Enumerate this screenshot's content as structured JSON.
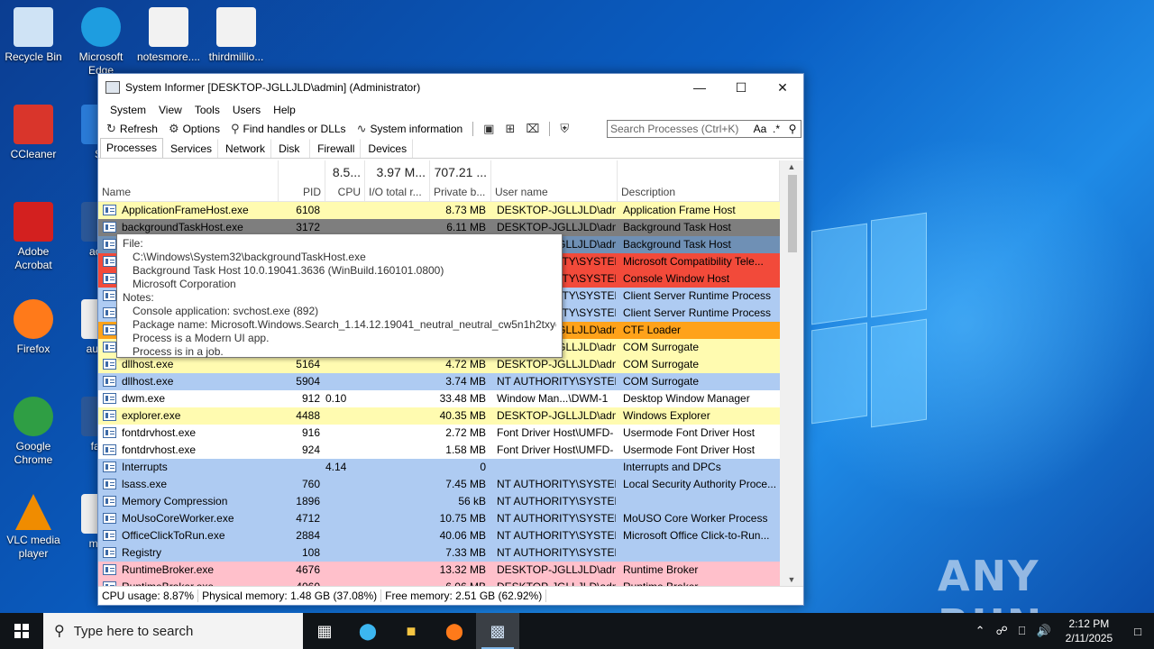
{
  "desktop": {
    "icons": [
      {
        "label": "Recycle Bin",
        "icon": "recycle-bin-icon",
        "color": "#cfe3f5"
      },
      {
        "label": "Microsoft Edge",
        "icon": "edge-icon",
        "color": "#1e9de0"
      },
      {
        "label": "notesmore....",
        "icon": "image-file-icon",
        "color": "#f2f2f2"
      },
      {
        "label": "thirdmillio...",
        "icon": "image-file-icon",
        "color": "#f2f2f2"
      },
      {
        "label": "CCleaner",
        "icon": "ccleaner-icon",
        "color": "#d9352b"
      },
      {
        "label": "Sk",
        "icon": "shortcut-icon",
        "color": "#2a7ad6"
      },
      {
        "label": "Adobe Acrobat",
        "icon": "acrobat-icon",
        "color": "#d3201f"
      },
      {
        "label": "acad",
        "icon": "word-icon",
        "color": "#2b5797"
      },
      {
        "label": "Firefox",
        "icon": "firefox-icon",
        "color": "#ff7a1a"
      },
      {
        "label": "augus",
        "icon": "file-icon",
        "color": "#eeeeee"
      },
      {
        "label": "Google Chrome",
        "icon": "chrome-icon",
        "color": "#2f9e44"
      },
      {
        "label": "fami",
        "icon": "word-icon",
        "color": "#2b5797"
      },
      {
        "label": "VLC media player",
        "icon": "vlc-icon",
        "color": "#f08c00"
      },
      {
        "label": "moth",
        "icon": "file-icon",
        "color": "#eeeeee"
      }
    ],
    "watermark": "ANY RUN"
  },
  "window": {
    "title": "System Informer [DESKTOP-JGLLJLD\\admin] (Administrator)",
    "menu": [
      "System",
      "View",
      "Tools",
      "Users",
      "Help"
    ],
    "toolbar": {
      "refresh": "Refresh",
      "options": "Options",
      "find": "Find handles or DLLs",
      "sysinfo": "System information"
    },
    "search_placeholder": "Search Processes (Ctrl+K)",
    "search_case": "Aa",
    "search_regex": ".*",
    "tabs": [
      "Processes",
      "Services",
      "Network",
      "Disk",
      "Firewall",
      "Devices"
    ],
    "columns": {
      "name": "Name",
      "pid": "PID",
      "cpu": "CPU",
      "cpu_total": "8.5...",
      "io": "I/O total r...",
      "io_total": "3.97 M...",
      "private": "Private b...",
      "private_total": "707.21 ...",
      "user": "User name",
      "desc": "Description"
    },
    "rows": [
      {
        "name": "ApplicationFrameHost.exe",
        "pid": "6108",
        "cpu": "",
        "priv": "8.73 MB",
        "user": "DESKTOP-JGLLJLD\\admi",
        "desc": "Application Frame Host",
        "bg": "#fffbb0"
      },
      {
        "name": "backgroundTaskHost.exe",
        "pid": "3172",
        "cpu": "",
        "priv": "6.11 MB",
        "user": "DESKTOP-JGLLJLD\\admi",
        "desc": "Background Task Host",
        "bg": "#7e7e7e"
      },
      {
        "name": "",
        "pid": "",
        "cpu": "",
        "priv": "",
        "user": "DESKTOP-JGLLJLD\\admi",
        "desc": "Background Task Host",
        "bg": "#6f90b5"
      },
      {
        "name": "",
        "pid": "",
        "cpu": "",
        "priv": "",
        "user": "NT AUTHORITY\\SYSTEM",
        "desc": "Microsoft Compatibility Tele...",
        "bg": "#f24a3a"
      },
      {
        "name": "",
        "pid": "",
        "cpu": "",
        "priv": "",
        "user": "NT AUTHORITY\\SYSTEM",
        "desc": "Console Window Host",
        "bg": "#f24a3a"
      },
      {
        "name": "",
        "pid": "",
        "cpu": "",
        "priv": "",
        "user": "NT AUTHORITY\\SYSTEM",
        "desc": "Client Server Runtime Process",
        "bg": "#aecbf2"
      },
      {
        "name": "",
        "pid": "",
        "cpu": "",
        "priv": "",
        "user": "NT AUTHORITY\\SYSTEM",
        "desc": "Client Server Runtime Process",
        "bg": "#aecbf2"
      },
      {
        "name": "",
        "pid": "",
        "cpu": "",
        "priv": "",
        "user": "DESKTOP-JGLLJLD\\admi",
        "desc": "CTF Loader",
        "bg": "#ffa21a"
      },
      {
        "name": "",
        "pid": "",
        "cpu": "",
        "priv": "",
        "user": "DESKTOP-JGLLJLD\\admi",
        "desc": "COM Surrogate",
        "bg": "#fffbb0"
      },
      {
        "name": "dllhost.exe",
        "pid": "5164",
        "cpu": "",
        "priv": "4.72 MB",
        "user": "DESKTOP-JGLLJLD\\admi",
        "desc": "COM Surrogate",
        "bg": "#fffbb0"
      },
      {
        "name": "dllhost.exe",
        "pid": "5904",
        "cpu": "",
        "priv": "3.74 MB",
        "user": "NT AUTHORITY\\SYSTEM",
        "desc": "COM Surrogate",
        "bg": "#aecbf2"
      },
      {
        "name": "dwm.exe",
        "pid": "912",
        "cpu": "0.10",
        "priv": "33.48 MB",
        "user": "Window Man...\\DWM-1",
        "desc": "Desktop Window Manager",
        "bg": "#ffffff"
      },
      {
        "name": "explorer.exe",
        "pid": "4488",
        "cpu": "",
        "priv": "40.35 MB",
        "user": "DESKTOP-JGLLJLD\\admi",
        "desc": "Windows Explorer",
        "bg": "#fffbb0"
      },
      {
        "name": "fontdrvhost.exe",
        "pid": "916",
        "cpu": "",
        "priv": "2.72 MB",
        "user": "Font Driver Host\\UMFD-",
        "desc": "Usermode Font Driver Host",
        "bg": "#ffffff"
      },
      {
        "name": "fontdrvhost.exe",
        "pid": "924",
        "cpu": "",
        "priv": "1.58 MB",
        "user": "Font Driver Host\\UMFD-",
        "desc": "Usermode Font Driver Host",
        "bg": "#ffffff"
      },
      {
        "name": "Interrupts",
        "pid": "",
        "cpu": "4.14",
        "priv": "0",
        "user": "",
        "desc": "Interrupts and DPCs",
        "bg": "#aecbf2"
      },
      {
        "name": "lsass.exe",
        "pid": "760",
        "cpu": "",
        "priv": "7.45 MB",
        "user": "NT AUTHORITY\\SYSTEM",
        "desc": "Local Security Authority Proce...",
        "bg": "#aecbf2"
      },
      {
        "name": "Memory Compression",
        "pid": "1896",
        "cpu": "",
        "priv": "56 kB",
        "user": "NT AUTHORITY\\SYSTEM",
        "desc": "",
        "bg": "#aecbf2"
      },
      {
        "name": "MoUsoCoreWorker.exe",
        "pid": "4712",
        "cpu": "",
        "priv": "10.75 MB",
        "user": "NT AUTHORITY\\SYSTEM",
        "desc": "MoUSO Core Worker Process",
        "bg": "#aecbf2"
      },
      {
        "name": "OfficeClickToRun.exe",
        "pid": "2884",
        "cpu": "",
        "priv": "40.06 MB",
        "user": "NT AUTHORITY\\SYSTEM",
        "desc": "Microsoft Office Click-to-Run...",
        "bg": "#aecbf2"
      },
      {
        "name": "Registry",
        "pid": "108",
        "cpu": "",
        "priv": "7.33 MB",
        "user": "NT AUTHORITY\\SYSTEM",
        "desc": "",
        "bg": "#aecbf2"
      },
      {
        "name": "RuntimeBroker.exe",
        "pid": "4676",
        "cpu": "",
        "priv": "13.32 MB",
        "user": "DESKTOP-JGLLJLD\\admi",
        "desc": "Runtime Broker",
        "bg": "#ffc0cb"
      },
      {
        "name": "RuntimeBroker.exe",
        "pid": "4060",
        "cpu": "",
        "priv": "6.06 MB",
        "user": "DESKTOP-JGLLJLD\\admi",
        "desc": "Runtime Broker",
        "bg": "#ffc0cb"
      }
    ],
    "tooltip": {
      "file_label": "File:",
      "path": "C:\\Windows\\System32\\backgroundTaskHost.exe",
      "version": "Background Task Host 10.0.19041.3636 (WinBuild.160101.0800)",
      "company": "Microsoft Corporation",
      "notes_label": "Notes:",
      "console": "Console application: svchost.exe (892)",
      "package": "Package name: Microsoft.Windows.Search_1.14.12.19041_neutral_neutral_cw5n1h2txyewy",
      "modern": "Process is a Modern UI app.",
      "job": "Process is in a job."
    },
    "status": {
      "cpu": "CPU usage: 8.87%",
      "physical": "Physical memory: 1.48 GB (37.08%)",
      "free": "Free memory: 2.51 GB (62.92%)"
    }
  },
  "taskbar": {
    "search_placeholder": "Type here to search",
    "time": "2:12 PM",
    "date": "2/11/2025"
  }
}
